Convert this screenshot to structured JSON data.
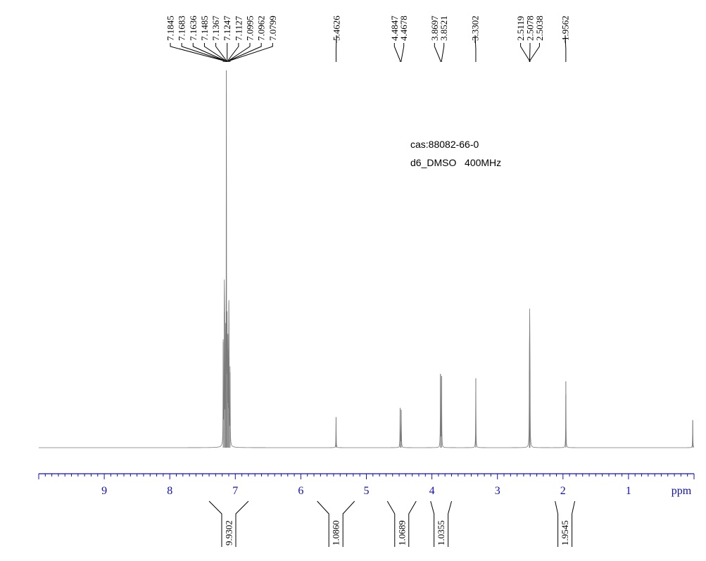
{
  "chart_data": {
    "type": "line",
    "title": "",
    "xlabel": "ppm",
    "ylabel": "",
    "xlim": [
      10.0,
      0.0
    ],
    "axis_reversed": true,
    "grid": false,
    "colors": {
      "spectrum": "#7a7a7a",
      "axis": "#1010b8",
      "labels": "#000000"
    },
    "x_ticks": [
      "9",
      "8",
      "7",
      "6",
      "5",
      "4",
      "3",
      "2",
      "1"
    ],
    "annotations": [
      "cas:88082-66-0",
      "d6_DMSO   400MHz"
    ],
    "peak_groups": [
      {
        "labels": [
          "7.1845",
          "7.1683",
          "7.1636",
          "7.1485",
          "7.1367",
          "7.1247",
          "7.1127",
          "7.0995",
          "7.0962",
          "7.0799"
        ]
      },
      {
        "labels": [
          "5.4626"
        ]
      },
      {
        "labels": [
          "4.4847",
          "4.4678"
        ]
      },
      {
        "labels": [
          "3.8697",
          "3.8521"
        ]
      },
      {
        "labels": [
          "3.3302"
        ]
      },
      {
        "labels": [
          "2.5119",
          "2.5078",
          "2.5038"
        ]
      },
      {
        "labels": [
          "1.9562"
        ]
      }
    ],
    "integrals": [
      {
        "label": "9.9302",
        "from": 7.4,
        "to": 6.8
      },
      {
        "label": "1.0860",
        "from": 5.75,
        "to": 5.18
      },
      {
        "label": "1.0689",
        "from": 4.68,
        "to": 4.24
      },
      {
        "label": "1.0355",
        "from": 4.02,
        "to": 3.7
      },
      {
        "label": "1.9545",
        "from": 2.12,
        "to": 1.82
      }
    ],
    "peaks": [
      {
        "ppm": 7.1845,
        "height": 0.28
      },
      {
        "ppm": 7.1683,
        "height": 0.36
      },
      {
        "ppm": 7.1636,
        "height": 0.34
      },
      {
        "ppm": 7.1485,
        "height": 0.3
      },
      {
        "ppm": 7.1367,
        "height": 1.0
      },
      {
        "ppm": 7.1247,
        "height": 0.3
      },
      {
        "ppm": 7.1127,
        "height": 0.26
      },
      {
        "ppm": 7.0995,
        "height": 0.3
      },
      {
        "ppm": 7.0962,
        "height": 0.24
      },
      {
        "ppm": 7.0799,
        "height": 0.2
      },
      {
        "ppm": 5.4626,
        "height": 0.081
      },
      {
        "ppm": 4.4847,
        "height": 0.105
      },
      {
        "ppm": 4.4678,
        "height": 0.1
      },
      {
        "ppm": 3.8697,
        "height": 0.195
      },
      {
        "ppm": 3.8521,
        "height": 0.19
      },
      {
        "ppm": 3.3302,
        "height": 0.184
      },
      {
        "ppm": 2.5119,
        "height": 0.205
      },
      {
        "ppm": 2.5078,
        "height": 0.258
      },
      {
        "ppm": 2.5038,
        "height": 0.205
      },
      {
        "ppm": 1.9562,
        "height": 0.176
      },
      {
        "ppm": 0.02,
        "height": 0.073
      }
    ]
  }
}
